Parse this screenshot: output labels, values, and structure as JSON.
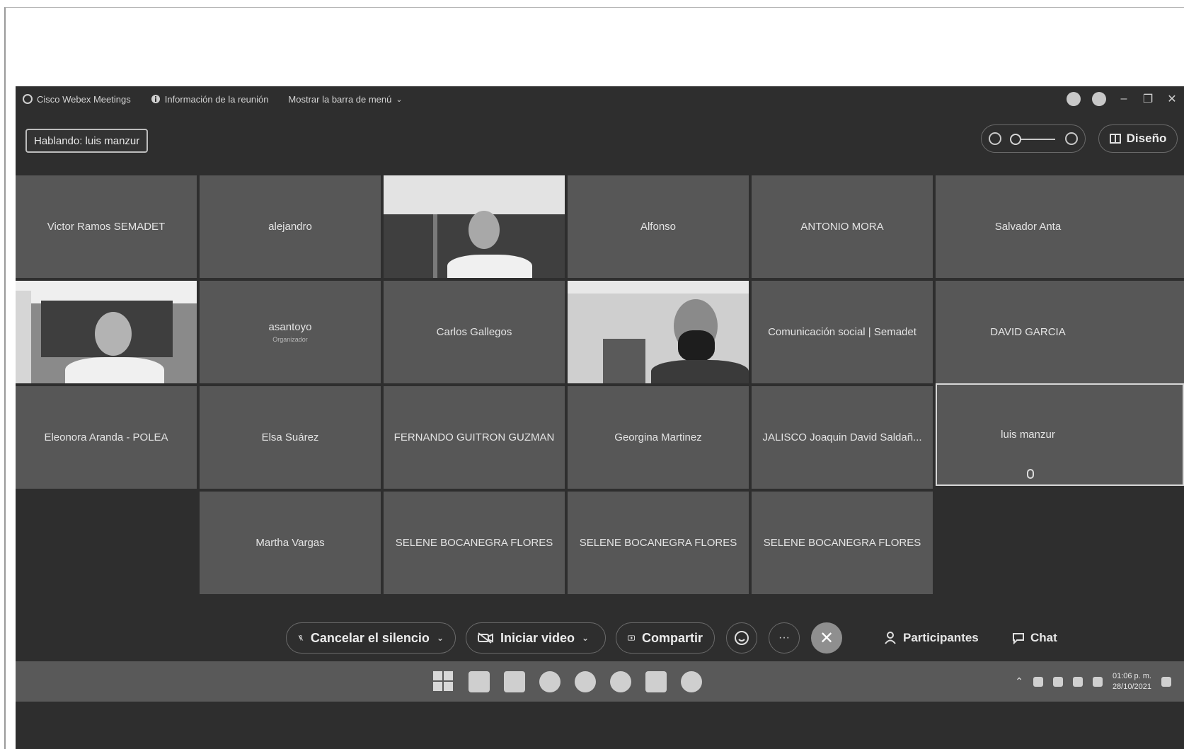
{
  "titlebar": {
    "app_name": "Cisco Webex Meetings",
    "meeting_info": "Información de la reunión",
    "menu_toggle": "Mostrar la barra de menú"
  },
  "speaking": "Hablando: luis manzur",
  "view": {
    "layout_label": "Diseño"
  },
  "participants": [
    {
      "name": "Victor Ramos SEMADET",
      "sub": "",
      "video": false
    },
    {
      "name": "alejandro",
      "sub": "",
      "video": false
    },
    {
      "name": "",
      "sub": "",
      "video": true
    },
    {
      "name": "Alfonso",
      "sub": "",
      "video": false
    },
    {
      "name": "ANTONIO MORA",
      "sub": "",
      "video": false
    },
    {
      "name": "Salvador Anta",
      "sub": "",
      "video": false
    },
    {
      "name": "",
      "sub": "",
      "video": true
    },
    {
      "name": "asantoyo",
      "sub": "Organizador",
      "video": false
    },
    {
      "name": "Carlos Gallegos",
      "sub": "",
      "video": false
    },
    {
      "name": "",
      "sub": "",
      "video": true
    },
    {
      "name": "Comunicación social | Semadet",
      "sub": "",
      "video": false
    },
    {
      "name": "DAVID GARCIA",
      "sub": "",
      "video": false
    },
    {
      "name": "Eleonora Aranda - POLEA",
      "sub": "",
      "video": false
    },
    {
      "name": "Elsa Suárez",
      "sub": "",
      "video": false
    },
    {
      "name": "FERNANDO GUITRON GUZMAN",
      "sub": "",
      "video": false
    },
    {
      "name": "Georgina Martinez",
      "sub": "",
      "video": false
    },
    {
      "name": "JALISCO Joaquin David Saldañ...",
      "sub": "",
      "video": false
    },
    {
      "name": "luis manzur",
      "sub": "",
      "video": false,
      "active": true
    },
    {
      "name": "Martha Vargas",
      "sub": "",
      "video": false
    },
    {
      "name": "SELENE BOCANEGRA FLORES",
      "sub": "",
      "video": false
    },
    {
      "name": "SELENE BOCANEGRA FLORES",
      "sub": "",
      "video": false
    },
    {
      "name": "SELENE BOCANEGRA FLORES",
      "sub": "",
      "video": false
    }
  ],
  "toolbar": {
    "mute": "Cancelar el silencio",
    "video": "Iniciar video",
    "share": "Compartir",
    "end": "✕",
    "more": "···",
    "participants": "Participantes",
    "chat": "Chat"
  },
  "taskbar": {
    "time": "01:06 p. m.",
    "date": "28/10/2021"
  }
}
